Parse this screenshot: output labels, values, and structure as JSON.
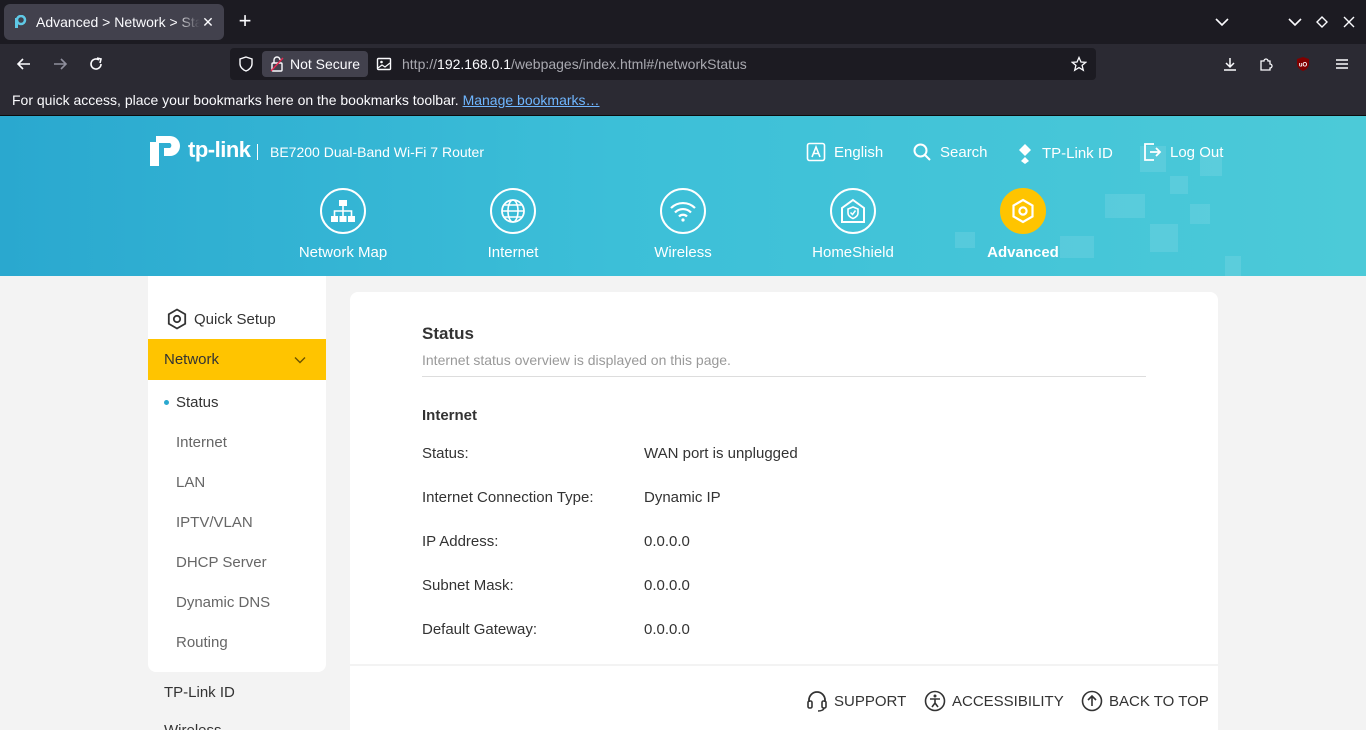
{
  "browser": {
    "tab_title": "Advanced > Network > Status",
    "security_label": "Not Secure",
    "url_prefix": "http://",
    "url_host": "192.168.0.1",
    "url_path": "/webpages/index.html#/networkStatus",
    "bookmarks_message": "For quick access, place your bookmarks here on the bookmarks toolbar.",
    "bookmarks_link": "Manage bookmarks…"
  },
  "header": {
    "brand": "tp-link",
    "model": "BE7200 Dual-Band Wi-Fi 7 Router",
    "links": {
      "language": "English",
      "search": "Search",
      "tplink_id": "TP-Link ID",
      "logout": "Log Out"
    },
    "nav": {
      "network_map": "Network Map",
      "internet": "Internet",
      "wireless": "Wireless",
      "homeshield": "HomeShield",
      "advanced": "Advanced"
    },
    "accent_color": "#ffc400"
  },
  "sidebar": {
    "quick_setup": "Quick Setup",
    "network": "Network",
    "sub_items": {
      "status": "Status",
      "internet": "Internet",
      "lan": "LAN",
      "iptv": "IPTV/VLAN",
      "dhcp": "DHCP Server",
      "ddns": "Dynamic DNS",
      "routing": "Routing"
    },
    "tplink_id": "TP-Link ID",
    "wireless": "Wireless"
  },
  "content": {
    "title": "Status",
    "description": "Internet status overview is displayed on this page.",
    "section": "Internet",
    "rows": [
      {
        "label": "Status:",
        "value": "WAN port is unplugged"
      },
      {
        "label": "Internet Connection Type:",
        "value": "Dynamic IP"
      },
      {
        "label": "IP Address:",
        "value": "0.0.0.0"
      },
      {
        "label": "Subnet Mask:",
        "value": "0.0.0.0"
      },
      {
        "label": "Default Gateway:",
        "value": "0.0.0.0"
      }
    ]
  },
  "footer": {
    "support": "SUPPORT",
    "accessibility": "ACCESSIBILITY",
    "back_to_top": "BACK TO TOP"
  }
}
